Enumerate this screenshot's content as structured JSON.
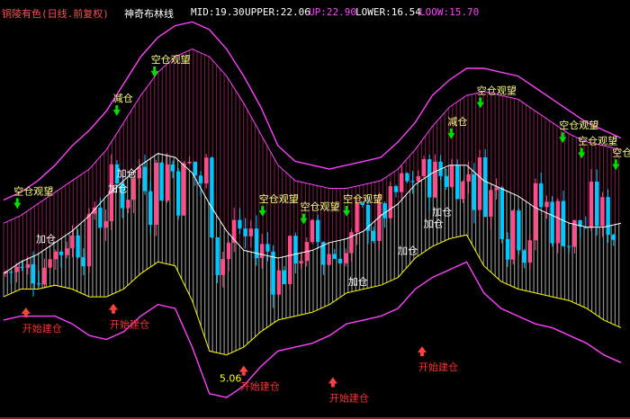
{
  "header": {
    "title": "铜陵有色(日线.前复权)",
    "indicator": "神奇布林线",
    "mid": "MID:19.30",
    "upper": "UPPER:22.06",
    "up": "UP:22.90",
    "lower": "LOWER:16.54",
    "loow": "LOOW:15.70"
  },
  "colors": {
    "background": "#000000",
    "title": "#ff5050",
    "white": "#ffffff",
    "magenta": "#ff40ff",
    "yellow": "#ffff00",
    "candle_up": "#ff4b8a",
    "candle_down": "#00c8ff",
    "buy_arrow": "#ff4040",
    "sell_arrow": "#00e000",
    "signal_red": "#ff3030",
    "signal_yellow": "#ffff80"
  },
  "chart_data": {
    "type": "candlestick",
    "title": "铜陵有色(日线.前复权) 神奇布林线",
    "ylim": [
      14.5,
      24.6
    ],
    "series": [
      {
        "name": "UPPER",
        "values": [
          19.3,
          19.5,
          19.8,
          20.1,
          20.4,
          20.7,
          21.2,
          21.9,
          22.6,
          23.2,
          23.6,
          23.8,
          23.6,
          23.1,
          22.4,
          21.6,
          20.8,
          20.4,
          20.3,
          20.2,
          20.2,
          20.3,
          20.4,
          20.7,
          21.2,
          21.8,
          22.3,
          22.6,
          22.7,
          22.6,
          22.5,
          22.2,
          21.9,
          21.6,
          21.4,
          21.3,
          21.2
        ]
      },
      {
        "name": "UP",
        "values": [
          19.9,
          20.1,
          20.4,
          20.8,
          21.3,
          21.7,
          22.2,
          22.9,
          23.6,
          24.1,
          24.4,
          24.5,
          24.3,
          23.8,
          23.1,
          22.3,
          21.3,
          20.9,
          20.8,
          20.7,
          20.8,
          20.9,
          21.0,
          21.4,
          21.9,
          22.6,
          23.0,
          23.3,
          23.3,
          23.2,
          23.1,
          22.8,
          22.5,
          22.2,
          21.9,
          21.7,
          21.5
        ]
      },
      {
        "name": "MID",
        "values": [
          18.0,
          18.3,
          18.5,
          18.8,
          19.1,
          19.5,
          20.0,
          20.4,
          20.8,
          21.1,
          21.0,
          20.6,
          19.8,
          19.1,
          18.6,
          18.5,
          18.4,
          18.5,
          18.6,
          18.8,
          18.9,
          19.1,
          19.5,
          19.8,
          20.3,
          20.6,
          20.8,
          20.8,
          20.4,
          20.2,
          20.0,
          19.7,
          19.5,
          19.3,
          19.2,
          19.2,
          19.3
        ]
      },
      {
        "name": "LOWER",
        "values": [
          17.4,
          17.6,
          17.6,
          17.7,
          17.6,
          17.4,
          17.4,
          17.6,
          18.0,
          18.3,
          18.2,
          17.3,
          16.0,
          15.9,
          16.1,
          16.5,
          16.8,
          16.9,
          17.0,
          17.2,
          17.5,
          17.6,
          17.7,
          17.9,
          18.4,
          18.7,
          18.9,
          19.0,
          18.2,
          17.8,
          17.6,
          17.5,
          17.4,
          17.3,
          17.1,
          16.8,
          16.6
        ]
      },
      {
        "name": "LOOW",
        "values": [
          16.8,
          16.9,
          16.9,
          16.9,
          16.7,
          16.4,
          16.3,
          16.5,
          16.9,
          17.2,
          17.1,
          16.1,
          14.9,
          14.8,
          15.1,
          15.6,
          16.0,
          16.1,
          16.2,
          16.4,
          16.7,
          16.8,
          16.9,
          17.1,
          17.6,
          17.9,
          18.1,
          18.3,
          17.5,
          17.1,
          16.9,
          16.7,
          16.6,
          16.4,
          16.2,
          15.9,
          15.7
        ]
      }
    ],
    "annotations": [
      {
        "text": "空仓观望",
        "x": 0.8,
        "y": 19.9,
        "color": "signal_yellow",
        "arrow": "down"
      },
      {
        "text": "空仓观望",
        "x": 8.8,
        "y": 23.3,
        "color": "signal_yellow",
        "arrow": "down"
      },
      {
        "text": "空仓观望",
        "x": 15.1,
        "y": 19.7,
        "color": "signal_yellow",
        "arrow": "down"
      },
      {
        "text": "空仓观望",
        "x": 17.5,
        "y": 19.5,
        "color": "signal_yellow",
        "arrow": "down"
      },
      {
        "text": "空仓观望",
        "x": 20.0,
        "y": 19.7,
        "color": "signal_yellow",
        "arrow": "down"
      },
      {
        "text": "空仓观望",
        "x": 27.8,
        "y": 22.5,
        "color": "signal_yellow",
        "arrow": "down"
      },
      {
        "text": "空仓观望",
        "x": 32.6,
        "y": 21.6,
        "color": "signal_yellow",
        "arrow": "down"
      },
      {
        "text": "空仓观望",
        "x": 33.7,
        "y": 21.2,
        "color": "signal_yellow",
        "arrow": "down"
      },
      {
        "text": "空仓观望",
        "x": 35.7,
        "y": 20.9,
        "color": "signal_yellow",
        "arrow": "down"
      },
      {
        "text": "减仓",
        "x": 6.6,
        "y": 22.3,
        "color": "signal_yellow",
        "arrow": "down"
      },
      {
        "text": "减仓",
        "x": 26.1,
        "y": 21.7,
        "color": "signal_yellow",
        "arrow": "down"
      },
      {
        "text": "加仓",
        "x": 2.1,
        "y": 18.9,
        "color": "white"
      },
      {
        "text": "加仓",
        "x": 6.3,
        "y": 20.2,
        "color": "white"
      },
      {
        "text": "加仓",
        "x": 6.8,
        "y": 20.6,
        "color": "white"
      },
      {
        "text": "加仓",
        "x": 20.3,
        "y": 17.8,
        "color": "white"
      },
      {
        "text": "加仓",
        "x": 23.2,
        "y": 18.6,
        "color": "white"
      },
      {
        "text": "加仓",
        "x": 24.7,
        "y": 19.3,
        "color": "white"
      },
      {
        "text": "加仓",
        "x": 25.2,
        "y": 19.6,
        "color": "white"
      },
      {
        "text": "开始建仓",
        "x": 1.3,
        "y": 17.1,
        "color": "signal_red",
        "arrow": "up"
      },
      {
        "text": "开始建仓",
        "x": 6.4,
        "y": 17.2,
        "color": "signal_red",
        "arrow": "up"
      },
      {
        "text": "开始建仓",
        "x": 14.0,
        "y": 15.6,
        "color": "signal_red",
        "arrow": "up"
      },
      {
        "text": "开始建仓",
        "x": 19.2,
        "y": 15.3,
        "color": "signal_red",
        "arrow": "up"
      },
      {
        "text": "开始建仓",
        "x": 24.4,
        "y": 16.1,
        "color": "signal_red",
        "arrow": "up"
      },
      {
        "text": "5.06",
        "x": 12.8,
        "y": 15.3,
        "color": "yellow"
      }
    ]
  }
}
